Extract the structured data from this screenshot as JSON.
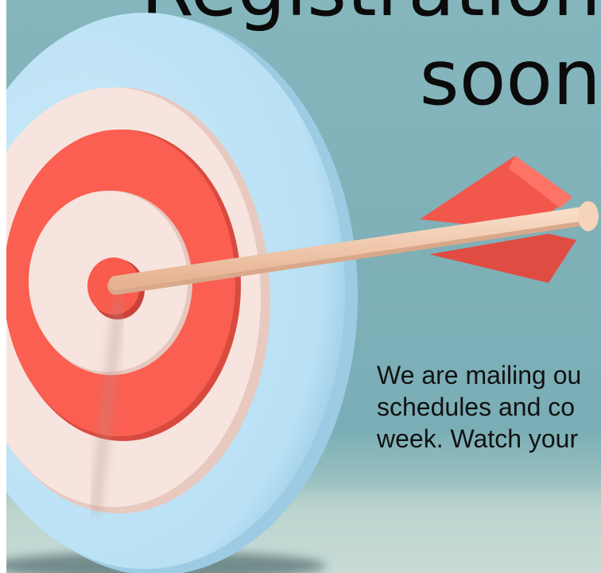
{
  "heading": {
    "line1": "Registration",
    "line2": "soon"
  },
  "body": {
    "lines": [
      "We are mailing ou",
      "schedules and co",
      "week. Watch your"
    ]
  },
  "colors": {
    "background": "#7fb0b8",
    "target_outer_ring": "#bfe3f6",
    "target_light_ring": "#f6e2dc",
    "target_red_ring": "#fb5f51",
    "arrow_shaft": "#f1c4a8",
    "arrow_fletching": "#f2574b",
    "text": "#111111"
  },
  "icons": {
    "target": "bullseye-target-icon",
    "arrow": "arrow-icon"
  }
}
